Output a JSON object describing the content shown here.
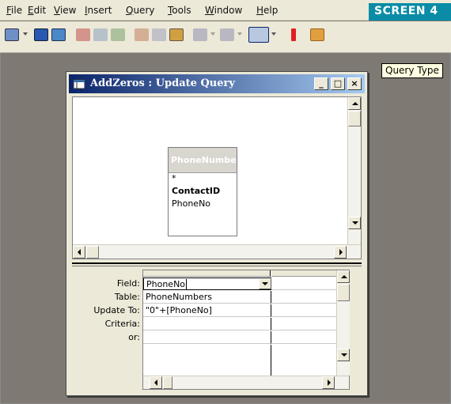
{
  "menu": [
    "File",
    "Edit",
    "View",
    "Insert",
    "Query",
    "Tools",
    "Window",
    "Help"
  ],
  "badge": "SCREEN 4",
  "tooltip": "Query Type",
  "window": {
    "title": "AddZeros : Update Query",
    "buttons": {
      "minimize": "_",
      "maximize": "□",
      "close": "×"
    }
  },
  "table_box": {
    "title": "PhoneNumbers",
    "fields": [
      "*",
      "ContactID",
      "PhoneNo"
    ]
  },
  "grid": {
    "row_labels": [
      "Field:",
      "Table:",
      "Update To:",
      "Criteria:",
      "or:"
    ],
    "column1": {
      "field": "PhoneNo",
      "table": "PhoneNumbers",
      "update_to": "\"0\"+[PhoneNo]",
      "criteria": "",
      "or": ""
    }
  },
  "colors": {
    "title_gradient_start": "#0a246a",
    "title_gradient_end": "#a6caf0",
    "badge": "#0a8ca7",
    "tooltip_bg": "#ffffe1"
  }
}
